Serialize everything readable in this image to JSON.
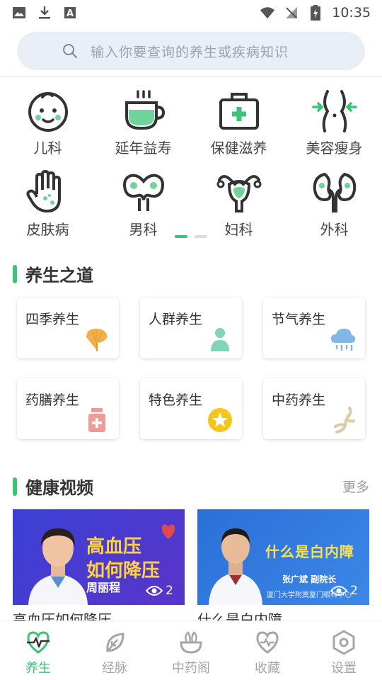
{
  "status_bar": {
    "time": "10:35"
  },
  "search": {
    "placeholder": "输入你要查询的养生或疾病知识"
  },
  "categories": [
    {
      "label": "儿科",
      "icon": "child-face-icon"
    },
    {
      "label": "延年益寿",
      "icon": "tea-cup-icon"
    },
    {
      "label": "保健滋养",
      "icon": "first-aid-kit-icon"
    },
    {
      "label": "美容瘦身",
      "icon": "waist-slim-icon"
    },
    {
      "label": "皮肤病",
      "icon": "hand-skin-icon"
    },
    {
      "label": "男科",
      "icon": "male-organ-icon"
    },
    {
      "label": "妇科",
      "icon": "uterus-icon"
    },
    {
      "label": "外科",
      "icon": "kidney-icon"
    }
  ],
  "sections": {
    "health_way": {
      "title": "养生之道"
    },
    "videos": {
      "title": "健康视频",
      "more": "更多"
    }
  },
  "health_cards": [
    {
      "label": "四季养生",
      "icon": "ginkgo-leaf-icon"
    },
    {
      "label": "人群养生",
      "icon": "person-icon"
    },
    {
      "label": "节气养生",
      "icon": "rain-cloud-icon"
    },
    {
      "label": "药膳养生",
      "icon": "medicine-bottle-icon"
    },
    {
      "label": "特色养生",
      "icon": "star-badge-icon"
    },
    {
      "label": "中药养生",
      "icon": "ginseng-root-icon"
    }
  ],
  "videos": [
    {
      "thumb_title_line1": "高血压",
      "thumb_title_line2": "如何降压",
      "thumb_name": "周丽程",
      "views": "2",
      "caption": "高血压如何降压"
    },
    {
      "thumb_title": "什么是白内障",
      "thumb_name": "张广斌  副院长",
      "thumb_sub": "厦门大学附属厦门眼科中心",
      "views": "2",
      "caption": "什么是白内障"
    }
  ],
  "bottom_nav": [
    {
      "label": "养生",
      "icon": "heartbeat-icon",
      "active": true
    },
    {
      "label": "经脉",
      "icon": "leaf-icon",
      "active": false
    },
    {
      "label": "中药阁",
      "icon": "herb-bowl-icon",
      "active": false
    },
    {
      "label": "收藏",
      "icon": "heart-outline-icon",
      "active": false
    },
    {
      "label": "设置",
      "icon": "settings-hexagon-icon",
      "active": false
    }
  ],
  "colors": {
    "accent": "#3ac474",
    "search_bg": "#e9eef7",
    "text": "#333333",
    "muted": "#a6a6a6"
  }
}
